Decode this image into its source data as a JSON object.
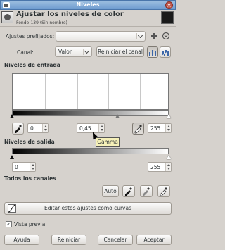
{
  "window": {
    "title": "Niveles"
  },
  "header": {
    "title": "Ajustar los niveles de color",
    "subtitle": "Fondo-139 (Sin nombre)"
  },
  "presets": {
    "label": "Ajustes prefijados:",
    "value": ""
  },
  "channel": {
    "label": "Canal:",
    "value": "Valor",
    "reset_label": "Reiniciar el canal"
  },
  "input_levels": {
    "label": "Niveles de entrada",
    "low": "0",
    "gamma": "0,45",
    "high": "255"
  },
  "tooltip": {
    "text": "Gamma"
  },
  "output_levels": {
    "label": "Niveles de salida",
    "low": "0",
    "high": "255"
  },
  "all_channels": {
    "label": "Todos los canales",
    "auto_label": "Auto"
  },
  "curves_button": {
    "label": "Editar estos ajustes como curvas"
  },
  "preview": {
    "label": "Vista previa",
    "checked": true
  },
  "buttons": {
    "help": "Ayuda",
    "reset": "Reiniciar",
    "cancel": "Cancelar",
    "ok": "Aceptar"
  }
}
